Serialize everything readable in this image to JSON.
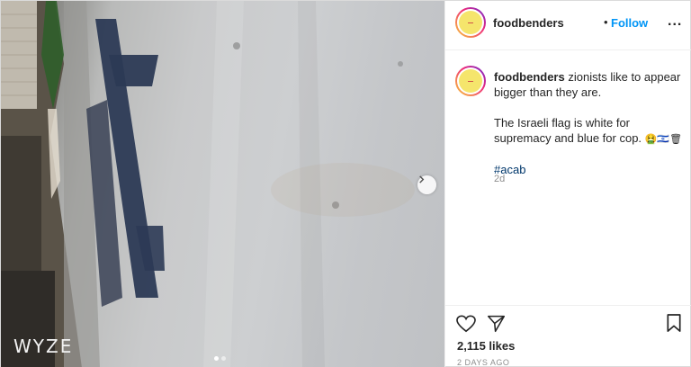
{
  "media": {
    "watermark": "WYZE",
    "carousel_count": 2,
    "carousel_active_index": 0
  },
  "header": {
    "username": "foodbenders",
    "separator": "•",
    "follow_label": "Follow",
    "more_label": "..."
  },
  "caption": {
    "username": "foodbenders",
    "line1": "zionists like to appear bigger than they are.",
    "line2": "The Israeli flag is white for supremacy and blue for cop.",
    "emojis": "🤮🇮🇱🗑",
    "hashtag": "#acab",
    "age": "2d"
  },
  "actions": {
    "icons": [
      "heart-icon",
      "share-icon",
      "bookmark-icon"
    ],
    "likes": "2,115 likes",
    "date": "2 DAYS AGO"
  },
  "colors": {
    "accent": "#0095f6",
    "hashtag": "#00376b",
    "muted": "#8e8e8e"
  }
}
